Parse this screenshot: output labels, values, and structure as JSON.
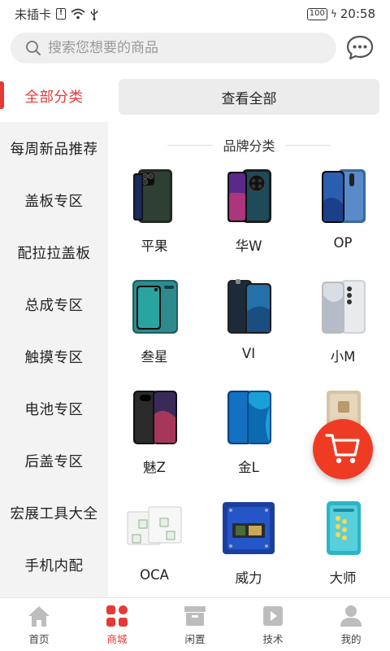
{
  "status_bar": {
    "carrier": "未插卡",
    "battery": "100",
    "time": "20:58"
  },
  "search": {
    "placeholder": "搜索您想要的商品"
  },
  "sidebar": {
    "items": [
      {
        "label": "全部分类",
        "active": true
      },
      {
        "label": "每周新品推荐"
      },
      {
        "label": "盖板专区"
      },
      {
        "label": "配拉拉盖板"
      },
      {
        "label": "总成专区"
      },
      {
        "label": "触摸专区"
      },
      {
        "label": "电池专区"
      },
      {
        "label": "后盖专区"
      },
      {
        "label": "宏展工具大全"
      },
      {
        "label": "手机内配"
      }
    ]
  },
  "main": {
    "view_all_label": "查看全部",
    "section_title": "品牌分类",
    "brands": [
      {
        "label": "平果"
      },
      {
        "label": "华W"
      },
      {
        "label": "OP"
      },
      {
        "label": "叁星"
      },
      {
        "label": "VI"
      },
      {
        "label": "小M"
      },
      {
        "label": "魅Z"
      },
      {
        "label": "金L"
      },
      {
        "label": ""
      },
      {
        "label": "OCA"
      },
      {
        "label": "威力"
      },
      {
        "label": "大师"
      }
    ]
  },
  "bottom_nav": {
    "tabs": [
      {
        "label": "首页",
        "icon": "home-icon"
      },
      {
        "label": "商城",
        "icon": "mall-grid-icon",
        "active": true
      },
      {
        "label": "闲置",
        "icon": "box-icon"
      },
      {
        "label": "技术",
        "icon": "play-icon"
      },
      {
        "label": "我的",
        "icon": "user-icon"
      }
    ]
  },
  "colors": {
    "accent": "#e53935",
    "cart_fab": "#ef3b24",
    "sidebar_bg": "#f3f3f3"
  }
}
